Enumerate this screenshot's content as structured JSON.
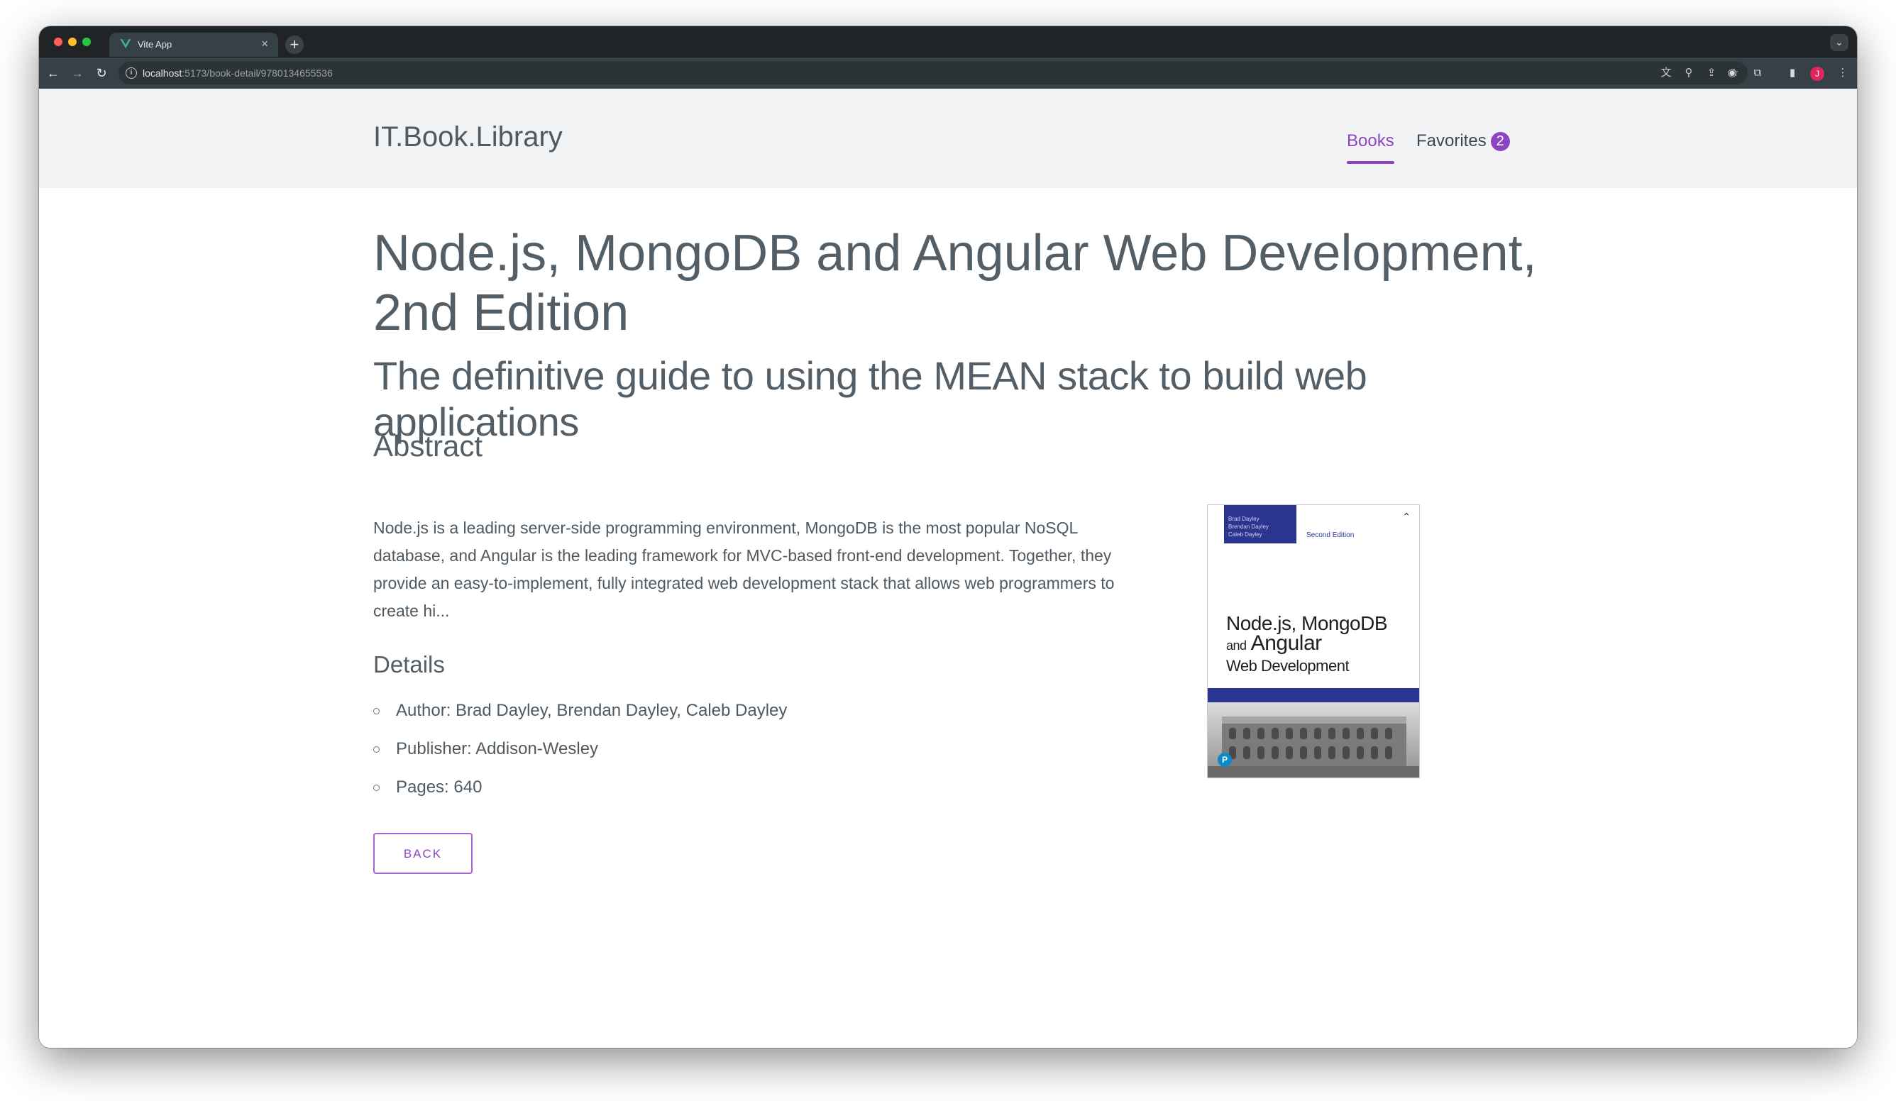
{
  "browser": {
    "tab_title": "Vite App",
    "tab_close": "×",
    "new_tab": "+",
    "url_host": "localhost",
    "url_rest": ":5173/book-detail/9780134655536",
    "profile_initial": "J"
  },
  "header": {
    "brand": "IT.Book.Library",
    "nav": {
      "books": "Books",
      "favorites": "Favorites",
      "favorites_count": "2"
    },
    "active_nav": "Books"
  },
  "book": {
    "title": "Node.js, MongoDB and Angular Web Development, 2nd Edition",
    "subtitle": "The definitive guide to using the MEAN stack to build web applications",
    "abstract_heading": "Abstract",
    "abstract": "Node.js is a leading server-side programming environment, MongoDB is the most popular NoSQL database, and Angular is the leading framework for MVC-based front-end development. Together, they provide an easy-to-implement, fully integrated web development stack that allows web programmers to create hi...",
    "details_heading": "Details",
    "details": [
      "Author: Brad Dayley, Brendan Dayley, Caleb Dayley",
      "Publisher: Addison-Wesley",
      "Pages: 640"
    ],
    "back_label": "BACK",
    "cover": {
      "authors": [
        "Brad Dayley",
        "Brendan Dayley",
        "Caleb Dayley"
      ],
      "edition": "Second Edition",
      "title_line1": "Node.js, MongoDB",
      "title_line2_small": "and",
      "title_line2": "Angular",
      "title_line3": "Web Development"
    }
  },
  "colors": {
    "accent": "#8e44c1",
    "header_bg": "#f2f3f5",
    "text": "#545e66",
    "cover_blue": "#2b3590"
  }
}
